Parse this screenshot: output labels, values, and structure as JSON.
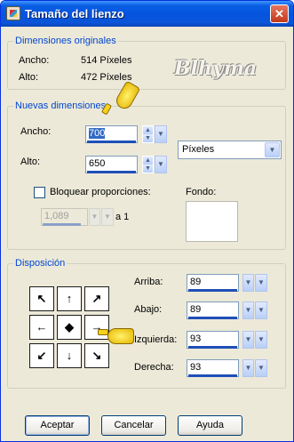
{
  "window": {
    "title": "Tamaño del lienzo",
    "close_glyph": "✕"
  },
  "watermark": "Blhyma",
  "original": {
    "group_label": "Dimensiones originales",
    "width_label": "Ancho:",
    "width_value": "514 Píxeles",
    "height_label": "Alto:",
    "height_value": "472 Píxeles"
  },
  "new": {
    "group_label": "Nuevas dimensiones",
    "width_label": "Ancho:",
    "width_value": "700",
    "height_label": "Alto:",
    "height_value": "650",
    "unit_value": "Píxeles",
    "lock_label": "Bloquear proporciones:",
    "ratio_value": "1,089",
    "ratio_suffix": "a 1",
    "background_label": "Fondo:",
    "background_color": "#ffffff"
  },
  "placement": {
    "group_label": "Disposición",
    "top_label": "Arriba:",
    "top_value": "89",
    "bottom_label": "Abajo:",
    "bottom_value": "89",
    "left_label": "Izquierda:",
    "left_value": "93",
    "right_label": "Derecha:",
    "right_value": "93",
    "anchor_glyphs": [
      "↖",
      "↑",
      "↗",
      "←",
      "◆",
      "→",
      "↙",
      "↓",
      "↘"
    ]
  },
  "buttons": {
    "ok": "Aceptar",
    "cancel": "Cancelar",
    "help": "Ayuda"
  },
  "icons": {
    "spin_up": "▲",
    "spin_down": "▼",
    "dropdown": "▼"
  },
  "colors": {
    "titlebar": "#0554e0",
    "group_label": "#0046d5",
    "highlight": "#316ac5"
  }
}
